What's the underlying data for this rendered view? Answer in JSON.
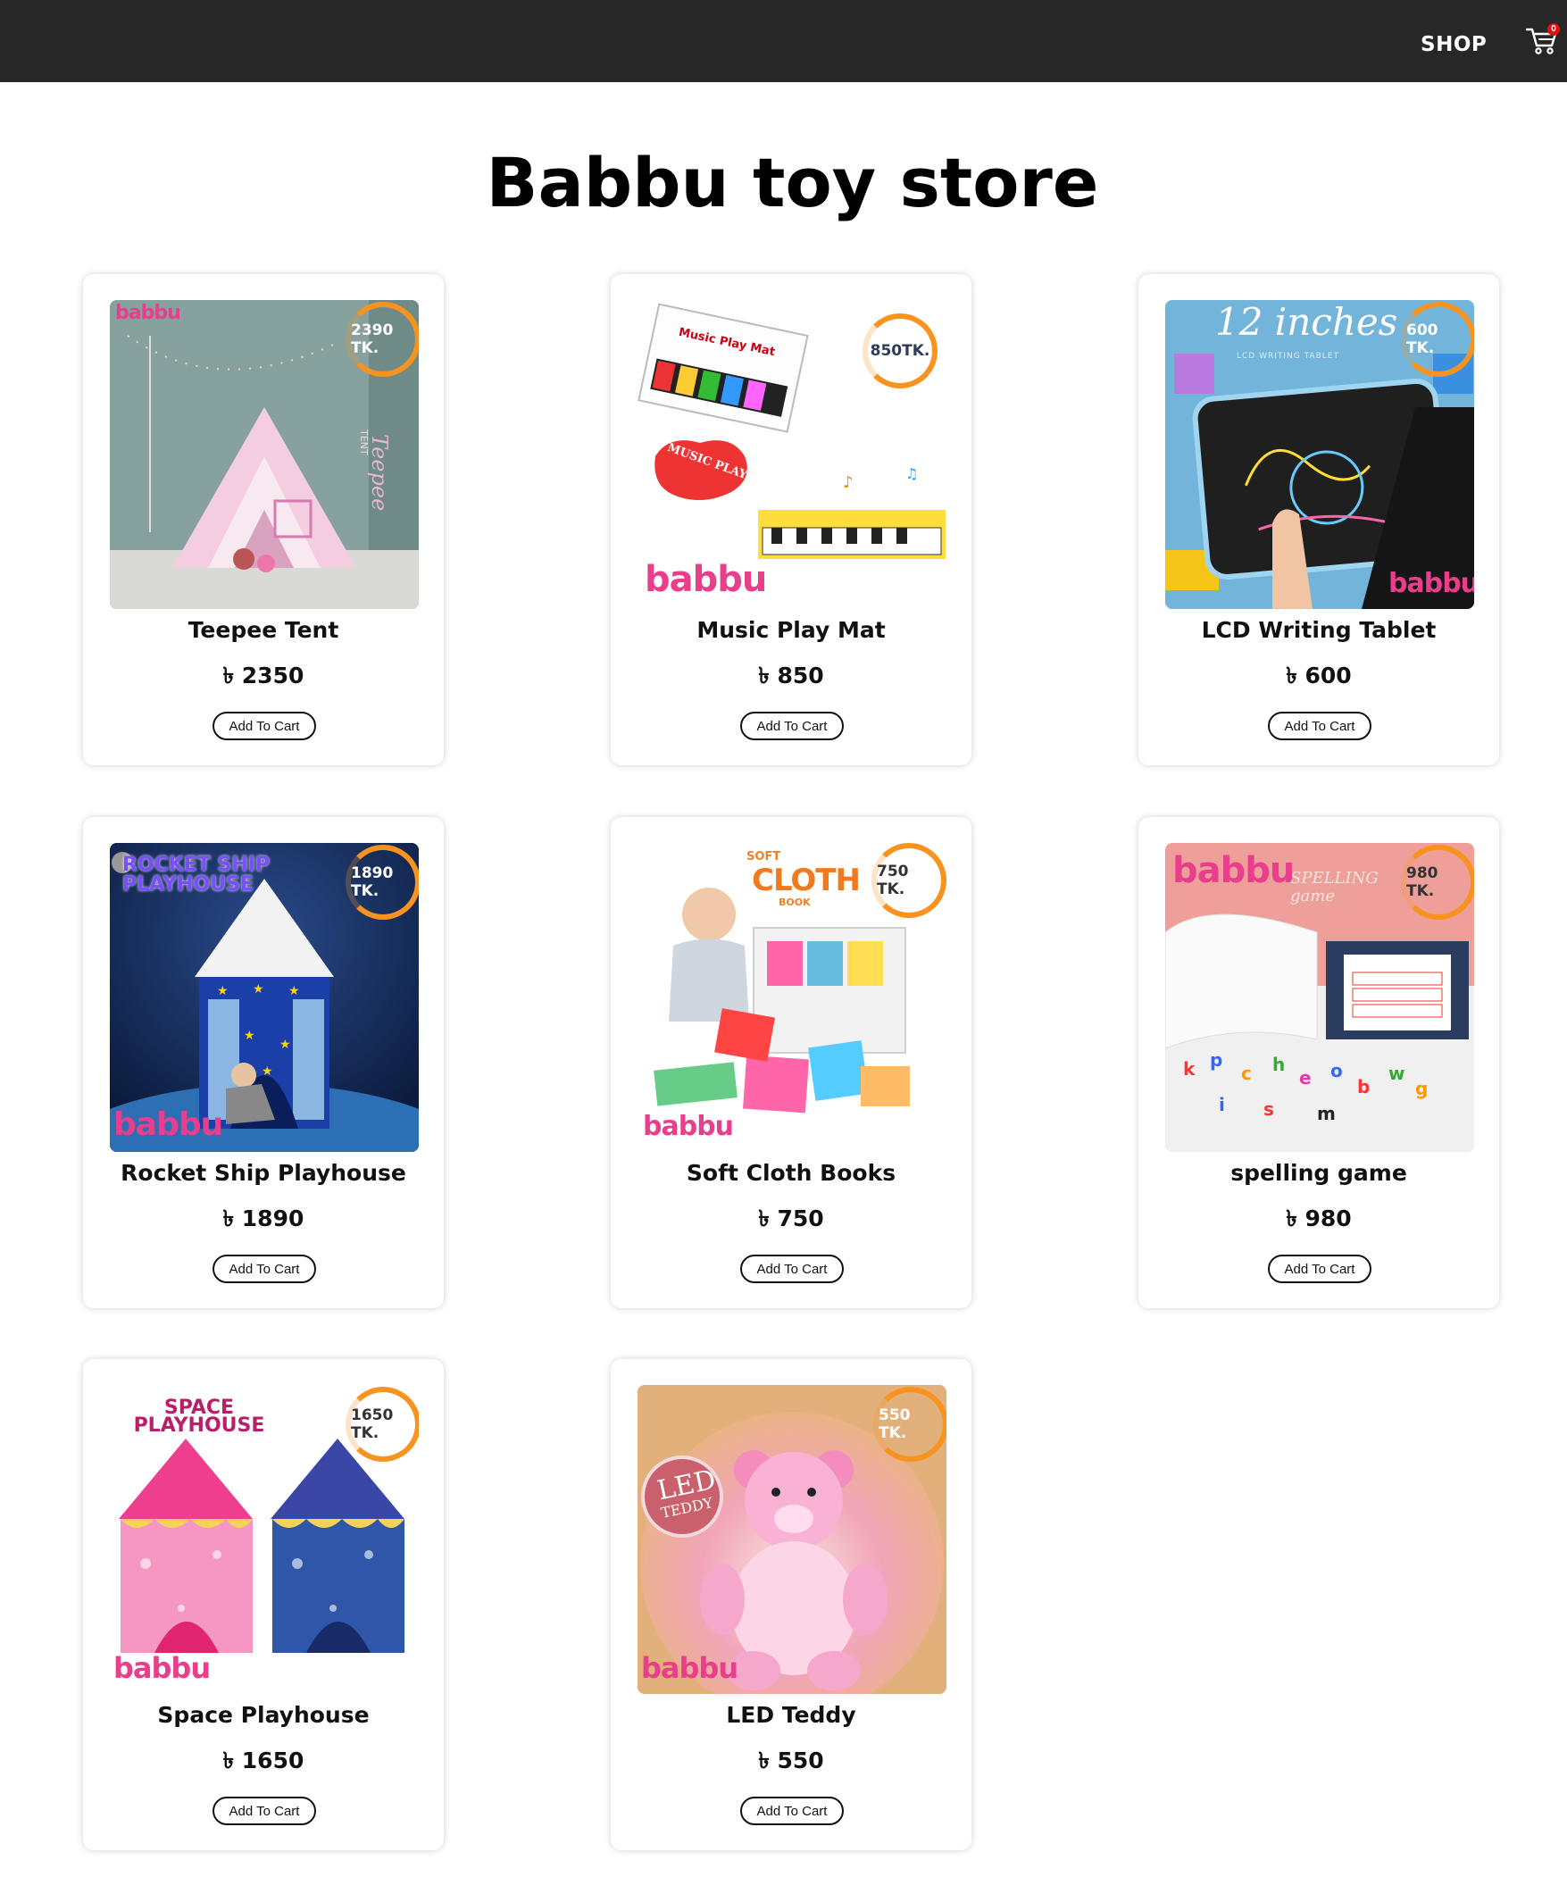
{
  "nav": {
    "shop_label": "SHOP",
    "cart_count": "0"
  },
  "page": {
    "title": "Babbu toy store"
  },
  "products": [
    {
      "name": "Teepee Tent",
      "price": "৳ 2350",
      "badge": "2390 TK.",
      "button": "Add To Cart",
      "image_text": "Teepee",
      "image_subtext": "TENT"
    },
    {
      "name": "Music Play Mat",
      "price": "৳ 850",
      "badge": "850TK.",
      "button": "Add To Cart",
      "image_text": "Music Play Mat",
      "image_subtext": "MUSIC PLAY MAT"
    },
    {
      "name": "LCD Writing Tablet",
      "price": "৳ 600",
      "badge": "600 TK.",
      "button": "Add To Cart",
      "image_text": "12 inches",
      "image_subtext": "LCD WRITING TABLET"
    },
    {
      "name": "Rocket Ship Playhouse",
      "price": "৳ 1890",
      "badge": "1890 TK.",
      "button": "Add To Cart",
      "image_text": "ROCKET SHIP PLAYHOUSE"
    },
    {
      "name": "Soft Cloth Books",
      "price": "৳ 750",
      "badge": "750 TK.",
      "button": "Add To Cart",
      "image_text": "CLOTH",
      "image_subtext": "SOFT",
      "image_subtext2": "BOOK"
    },
    {
      "name": "spelling game",
      "price": "৳ 980",
      "badge": "980 TK.",
      "button": "Add To Cart",
      "image_text": "SPELLING game"
    },
    {
      "name": "Space Playhouse",
      "price": "৳ 1650",
      "badge": "1650 TK.",
      "button": "Add To Cart",
      "image_text": "SPACE PLAYHOUSE"
    },
    {
      "name": "LED Teddy",
      "price": "৳ 550",
      "badge": "550 TK.",
      "button": "Add To Cart",
      "image_text": "LED",
      "image_subtext": "TEDDY"
    }
  ],
  "brand": {
    "logo_text": "babbu",
    "badge_color": "#f7931e",
    "nav_bg": "#272727"
  }
}
